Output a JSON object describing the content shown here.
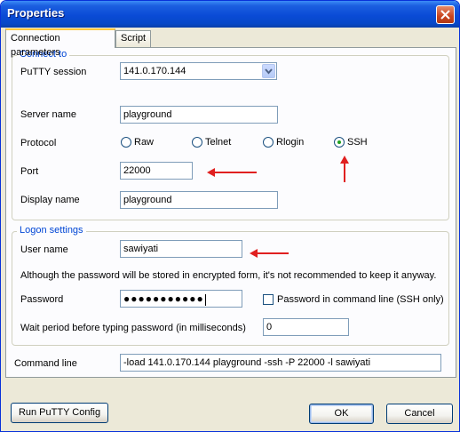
{
  "window": {
    "title": "Properties"
  },
  "tabs": [
    {
      "label": "Connection parameters",
      "active": true
    },
    {
      "label": "Script",
      "active": false
    }
  ],
  "connect_to": {
    "legend": "Connect to",
    "putty_session_label": "PuTTY session",
    "putty_session_value": "141.0.170.144",
    "server_name_label": "Server name",
    "server_name_value": "playground",
    "protocol_label": "Protocol",
    "protocols": [
      {
        "label": "Raw",
        "selected": false
      },
      {
        "label": "Telnet",
        "selected": false
      },
      {
        "label": "Rlogin",
        "selected": false
      },
      {
        "label": "SSH",
        "selected": true
      }
    ],
    "port_label": "Port",
    "port_value": "22000",
    "display_name_label": "Display name",
    "display_name_value": "playground"
  },
  "logon": {
    "legend": "Logon settings",
    "user_name_label": "User name",
    "user_name_value": "sawiyati",
    "warning": "Although the password will be stored in encrypted form, it's not recommended to keep it anyway.",
    "password_label": "Password",
    "password_mask": "●●●●●●●●●●●",
    "password_in_cmdline_label": "Password in command line (SSH only)",
    "password_in_cmdline_checked": false,
    "wait_label": "Wait period before typing password (in milliseconds)",
    "wait_value": "0"
  },
  "command_line": {
    "label": "Command line",
    "value": "-load 141.0.170.144 playground -ssh -P 22000 -l sawiyati"
  },
  "buttons": {
    "run_config": "Run PuTTY Config",
    "ok": "OK",
    "cancel": "Cancel"
  },
  "colors": {
    "titlebar": "#0a4bd6",
    "annotation_arrow": "#e02020",
    "group_legend": "#0046d5"
  }
}
